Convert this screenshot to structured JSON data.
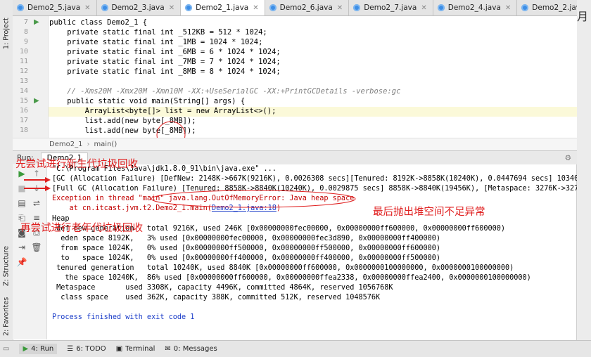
{
  "left_strip": {
    "project": "1: Project",
    "structure": "Z: Structure",
    "favorites": "2: Favorites"
  },
  "tabs": [
    {
      "label": "Demo2_5.java",
      "active": false
    },
    {
      "label": "Demo2_3.java",
      "active": false
    },
    {
      "label": "Demo2_1.java",
      "active": true
    },
    {
      "label": "Demo2_6.java",
      "active": false
    },
    {
      "label": "Demo2_7.java",
      "active": false
    },
    {
      "label": "Demo2_4.java",
      "active": false
    },
    {
      "label": "Demo2_2.java",
      "active": false
    }
  ],
  "editor": {
    "line_numbers": [
      "7",
      "8",
      "9",
      "10",
      "11",
      "12",
      "13",
      "14",
      "15",
      "16",
      "17",
      "18"
    ],
    "lines": [
      "public class Demo2_1 {",
      "    private static final int _512KB = 512 * 1024;",
      "    private static final int _1MB = 1024 * 1024;",
      "    private static final int _6MB = 6 * 1024 * 1024;",
      "    private static final int _7MB = 7 * 1024 * 1024;",
      "    private static final int _8MB = 8 * 1024 * 1024;",
      "",
      "    // -Xms20M -Xmx20M -Xmn10M -XX:+UseSerialGC -XX:+PrintGCDetails -verbose:gc",
      "    public static void main(String[] args) {",
      "        ArrayList<byte[]> list = new ArrayList<>();",
      "        list.add(new byte[_8MB]);",
      "        list.add(new byte[_8MB]);"
    ]
  },
  "breadcrumb": {
    "class": "Demo2_1",
    "method": "main()"
  },
  "run": {
    "label": "Run:",
    "tab": "Demo2_1",
    "console": [
      "\"C:\\Program Files\\Java\\jdk1.8.0_91\\bin\\java.exe\" ...",
      "[GC (Allocation Failure) [DefNew: 2148K->667K(9216K), 0.0026308 secs][Tenured: 8192K->8858K(10240K), 0.0447694 secs] 10340K->885",
      "[Full GC (Allocation Failure) [Tenured: 8858K->8840K(10240K), 0.0029875 secs] 8858K->8840K(19456K), [Metaspace: 3276K->3276K(105",
      "Exception in thread \"main\" java.lang.OutOfMemoryError: Java heap space",
      "    at cn.itcast.jvm.t2.Demo2_1.main(",
      "Demo2_1.java:18",
      ")",
      "Heap",
      " def new generation   total 9216K, used 246K [0x00000000fec00000, 0x00000000ff600000, 0x00000000ff600000)",
      "  eden space 8192K,   3% used [0x00000000fec00000, 0x00000000fec3d890, 0x00000000ff400000)",
      "  from space 1024K,   0% used [0x00000000ff500000, 0x00000000ff500000, 0x00000000ff600000)",
      "  to   space 1024K,   0% used [0x00000000ff400000, 0x00000000ff400000, 0x00000000ff500000)",
      " tenured generation   total 10240K, used 8840K [0x00000000ff600000, 0x0000000100000000, 0x0000000100000000)",
      "   the space 10240K,  86% used [0x00000000ff600000, 0x00000000ffea2338, 0x00000000ffea2400, 0x0000000100000000)",
      " Metaspace       used 3308K, capacity 4496K, committed 4864K, reserved 1056768K",
      "  class space    used 362K, capacity 388K, committed 512K, reserved 1048576K",
      "",
      "Process finished with exit code 1"
    ]
  },
  "bottom_bar": {
    "run": "4: Run",
    "todo": "6: TODO",
    "terminal": "Terminal",
    "messages": "0: Messages"
  },
  "annotations": {
    "young_gc": "先尝试进行新生代垃圾回收",
    "old_gc": "再尝试进行老年代垃圾回收",
    "oom": "最后抛出堆空间不足异常",
    "corner": "月"
  },
  "colors": {
    "annotation": "#e02020",
    "error": "#c00000",
    "keyword": "#000080",
    "selection": "#214283"
  }
}
